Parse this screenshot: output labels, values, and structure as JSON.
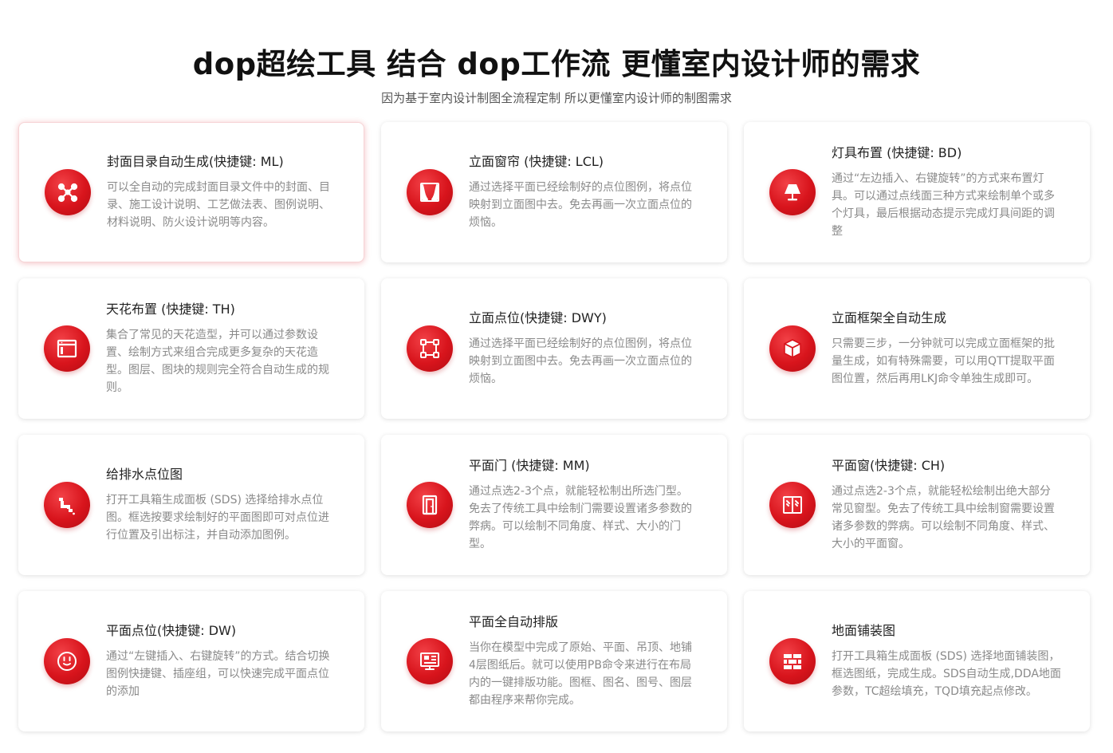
{
  "header": {
    "title": "dop超绘工具 结合 dop工作流 更懂室内设计师的需求",
    "subtitle": "因为基于室内设计制图全流程定制 所以更懂室内设计师的制图需求"
  },
  "colors": {
    "accent": "#d8141c",
    "card_border_highlight": "#f6d4d6",
    "description_text": "#8a8a8a"
  },
  "cards": [
    {
      "icon": "node-network-icon",
      "title": "封面目录自动生成(快捷键: ML)",
      "description": "可以全自动的完成封面目录文件中的封面、目录、施工设计说明、工艺做法表、图例说明、材料说明、防火设计说明等内容。"
    },
    {
      "icon": "curtain-icon",
      "title": "立面窗帘 (快捷键: LCL)",
      "description": "通过选择平面已经绘制好的点位图例，将点位映射到立面图中去。免去再画一次立面点位的烦恼。"
    },
    {
      "icon": "lamp-icon",
      "title": "灯具布置 (快捷键: BD)",
      "description": "通过“左边插入、右键旋转”的方式来布置灯具。可以通过点线面三种方式来绘制单个或多个灯具，最后根据动态提示完成灯具间距的调整"
    },
    {
      "icon": "ceiling-layout-icon",
      "title": "天花布置 (快捷键: TH)",
      "description": "集合了常见的天花造型，并可以通过参数设置、绘制方式来组合完成更多复杂的天花造型。图层、图块的规则完全符合自动生成的规则。"
    },
    {
      "icon": "node-frame-icon",
      "title": "立面点位(快捷键: DWY)",
      "description": "通过选择平面已经绘制好的点位图例，将点位映射到立面图中去。免去再画一次立面点位的烦恼。"
    },
    {
      "icon": "cube-icon",
      "title": "立面框架全自动生成",
      "description": "只需要三步，一分钟就可以完成立面框架的批量生成，如有特殊需要，可以用QTT提取平面图位置，然后再用LKJ命令单独生成即可。"
    },
    {
      "icon": "water-pipe-icon",
      "title": "给排水点位图",
      "description": "打开工具箱生成面板 (SDS) 选择给排水点位图。框选按要求绘制好的平面图即可对点位进行位置及引出标注，并自动添加图例。"
    },
    {
      "icon": "door-icon",
      "title": "平面门 (快捷键: MM)",
      "description": "通过点选2-3个点，就能轻松制出所选门型。免去了传统工具中绘制门需要设置诸多参数的弊病。可以绘制不同角度、样式、大小的门型。"
    },
    {
      "icon": "window-icon",
      "title": "平面窗(快捷键: CH)",
      "description": "通过点选2-3个点，就能轻松绘制出绝大部分常见窗型。免去了传统工具中绘制窗需要设置诸多参数的弊病。可以绘制不同角度、样式、大小的平面窗。"
    },
    {
      "icon": "power-socket-icon",
      "title": "平面点位(快捷键: DW)",
      "description": "通过“左键插入、右键旋转”的方式。结合切换图例快捷键、插座组，可以快速完成平面点位的添加"
    },
    {
      "icon": "monitor-layout-icon",
      "title": "平面全自动排版",
      "description": "当你在模型中完成了原始、平面、吊顶、地铺4层图纸后。就可以使用PB命令来进行在布局内的一键排版功能。图框、图名、图号、图层都由程序来帮你完成。"
    },
    {
      "icon": "floor-tile-icon",
      "title": "地面铺装图",
      "description": "打开工具箱生成面板 (SDS) 选择地面铺装图，框选图纸，完成生成。SDS自动生成,DDA地面参数，TC超绘填充，TQD填充起点修改。"
    }
  ]
}
